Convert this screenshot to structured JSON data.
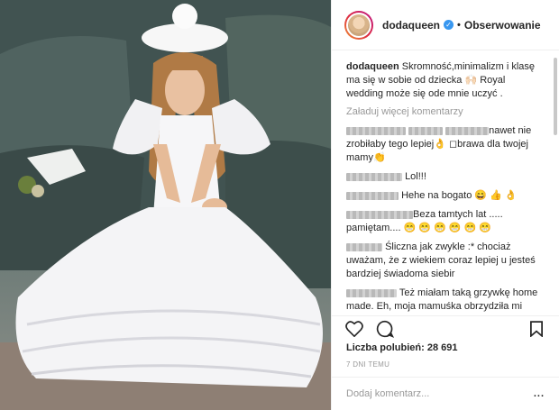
{
  "post": {
    "username": "dodaqueen",
    "follow_label": "Obserwowanie",
    "caption_user": "dodaqueen",
    "caption_text": "Skromność,minimalizm i klasę ma się w sobie od dziecka 🙌🏻 Royal wedding może się ode mnie uczyć .",
    "load_more": "Załaduj więcej komentarzy",
    "likes": "Liczba polubień: 28 691",
    "timestamp": "7 DNI TEMU",
    "add_comment_placeholder": "Dodaj komentarz...",
    "more_label": "..."
  },
  "comments": [
    {
      "text": "nawet nie zrobiłaby tego lepiej👌 ◻brawa dla twojej mamy👏"
    },
    {
      "text": "Lol!!!"
    },
    {
      "text": "Hehe na bogato 😄 👍 👌"
    },
    {
      "text": "Beza tamtych lat ..... pamiętam.... 😁 😁 😁 😁 😁 😁"
    },
    {
      "text": "Śliczna jak zwykle :* chociaż uważam, że z wiekiem coraz lepiej u jesteś bardziej świadoma siebir"
    },
    {
      "text": "Też miałam taką grzywkę home made. Eh, moja mamuśka obrzydziła mi grzywkę na maksa 😂 😂 😂 za to ja swoją córkę strzygę tak samo 😂"
    }
  ],
  "icons": [
    "verified-icon",
    "heart-icon",
    "comment-icon",
    "bookmark-icon"
  ],
  "colors": {
    "verified": "#3897f0",
    "muted": "#999999",
    "text": "#262626"
  }
}
